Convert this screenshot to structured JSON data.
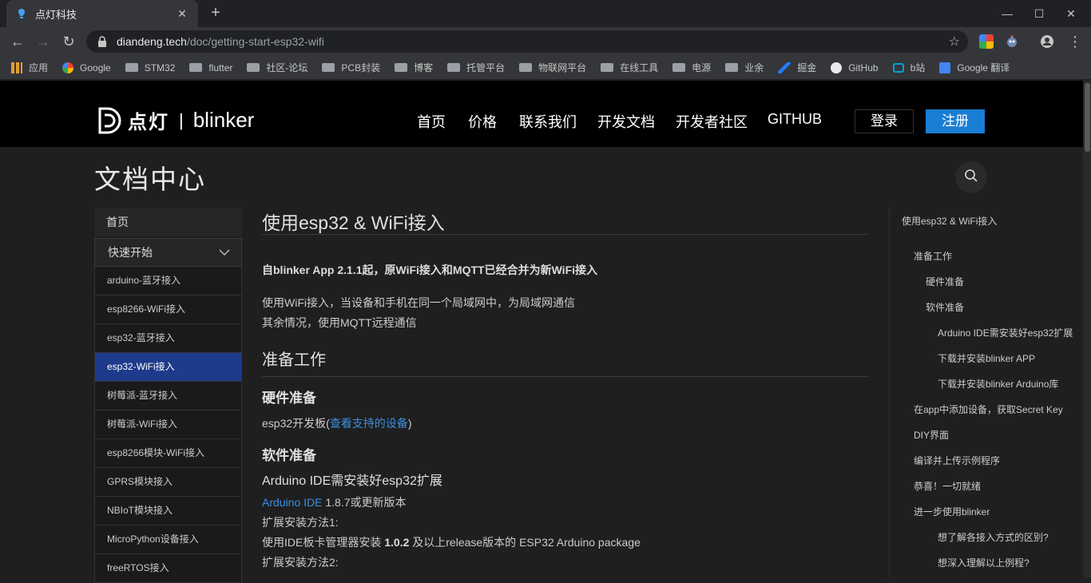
{
  "browser": {
    "tab_title": "点灯科技",
    "url_host": "diandeng.tech",
    "url_path": "/doc/getting-start-esp32-wifi",
    "bookmarks": [
      {
        "label": "应用",
        "icon": "apps-grid-icon"
      },
      {
        "label": "Google",
        "icon": "google-icon"
      },
      {
        "label": "STM32",
        "icon": "folder-icon"
      },
      {
        "label": "flutter",
        "icon": "folder-icon"
      },
      {
        "label": "社区-论坛",
        "icon": "folder-icon"
      },
      {
        "label": "PCB封装",
        "icon": "folder-icon"
      },
      {
        "label": "博客",
        "icon": "folder-icon"
      },
      {
        "label": "托管平台",
        "icon": "folder-icon"
      },
      {
        "label": "物联网平台",
        "icon": "folder-icon"
      },
      {
        "label": "在线工具",
        "icon": "folder-icon"
      },
      {
        "label": "电源",
        "icon": "folder-icon"
      },
      {
        "label": "业余",
        "icon": "folder-icon"
      },
      {
        "label": "掘金",
        "icon": "juejin-icon"
      },
      {
        "label": "GitHub",
        "icon": "github-icon"
      },
      {
        "label": "b站",
        "icon": "bilibili-icon"
      },
      {
        "label": "Google 翻译",
        "icon": "google-translate-icon"
      }
    ]
  },
  "site": {
    "logo_cn": "点灯",
    "logo_sep": "|",
    "logo_en": "blinker",
    "nav": [
      "首页",
      "价格",
      "联系我们",
      "开发文档",
      "开发者社区",
      "GITHUB"
    ],
    "login": "登录",
    "register": "注册"
  },
  "page": {
    "doc_title": "文档中心",
    "sidebar": {
      "home": "首页",
      "group": "快速开始",
      "items": [
        "arduino-蓝牙接入",
        "esp8266-WiFi接入",
        "esp32-蓝牙接入",
        "esp32-WiFi接入",
        "树莓派-蓝牙接入",
        "树莓派-WiFi接入",
        "esp8266模块-WiFi接入",
        "GPRS模块接入",
        "NBIoT模块接入",
        "MicroPython设备接入",
        "freeRTOS接入"
      ],
      "active_index": 3
    },
    "article": {
      "title": "使用esp32 & WiFi接入",
      "notice": "自blinker App 2.1.1起，原WiFi接入和MQTT已经合并为新WiFi接入",
      "intro1": "使用WiFi接入，当设备和手机在同一个局域网中，为局域网通信",
      "intro2": "其余情况，使用MQTT远程通信",
      "prep_heading": "准备工作",
      "hw_heading": "硬件准备",
      "hw_text": "esp32开发板(",
      "hw_link": "查看支持的设备",
      "hw_text_end": ")",
      "sw_heading": "软件准备",
      "ide_heading": "Arduino IDE需安装好esp32扩展",
      "ide_link": "Arduino IDE",
      "ide_version": " 1.8.7或更新版本",
      "method1": "扩展安装方法1:",
      "method1_pre": "使用IDE板卡管理器安装 ",
      "method1_ver": "1.0.2",
      "method1_post": " 及以上release版本的 ESP32 Arduino package",
      "method2": "扩展安装方法2:"
    },
    "toc": [
      "使用esp32 & WiFi接入",
      "准备工作",
      "硬件准备",
      "软件准备",
      "Arduino IDE需安装好esp32扩展",
      "下载并安装blinker APP",
      "下载并安装blinker Arduino库",
      "在app中添加设备，获取Secret Key",
      "DIY界面",
      "编译并上传示例程序",
      "恭喜！一切就绪",
      "进一步使用blinker",
      "想了解各接入方式的区别?",
      "想深入理解以上例程?"
    ]
  }
}
